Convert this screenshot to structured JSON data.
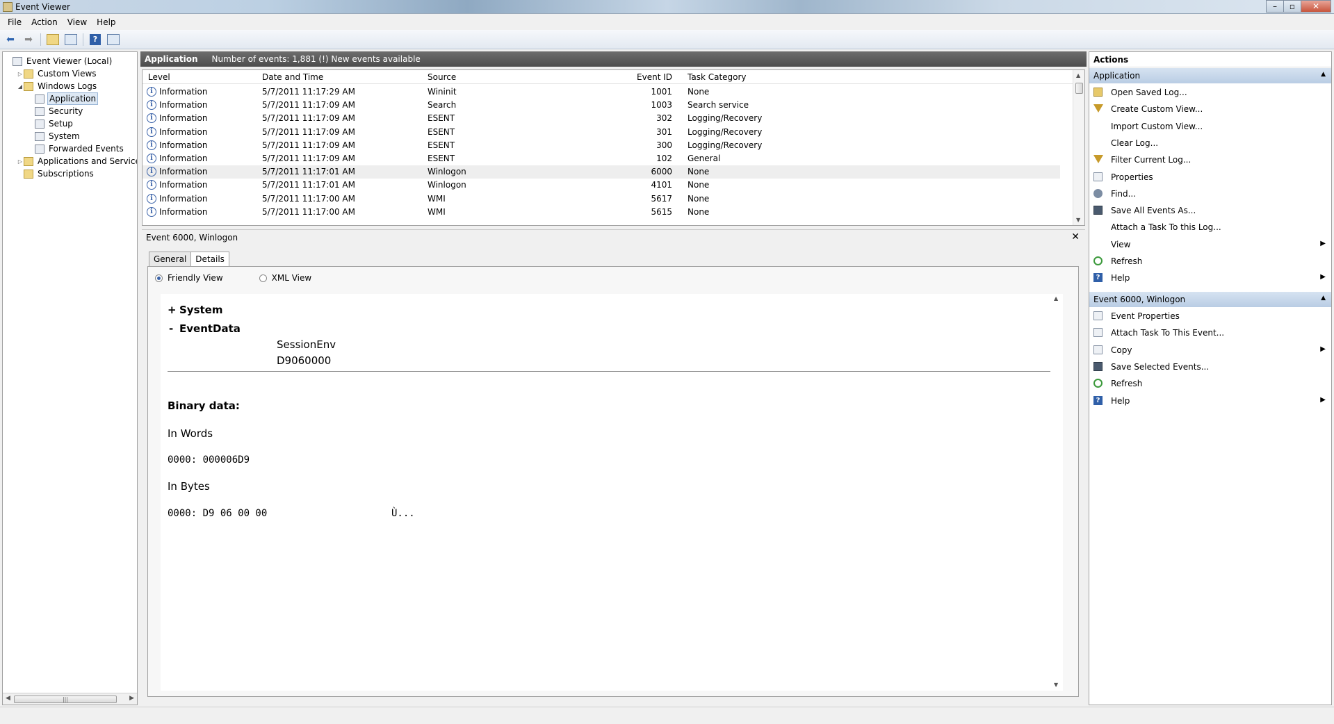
{
  "window": {
    "title": "Event Viewer",
    "controls": [
      "–",
      "▫",
      "✕"
    ]
  },
  "menu": [
    "File",
    "Action",
    "View",
    "Help"
  ],
  "tree": {
    "items": [
      {
        "label": "Event Viewer (Local)",
        "indent": 0,
        "expander": "",
        "icon": "log",
        "selected": false
      },
      {
        "label": "Custom Views",
        "indent": 1,
        "expander": "▷",
        "icon": "folder",
        "selected": false
      },
      {
        "label": "Windows Logs",
        "indent": 1,
        "expander": "◢",
        "icon": "folder",
        "selected": false
      },
      {
        "label": "Application",
        "indent": 2,
        "expander": "",
        "icon": "log",
        "selected": true
      },
      {
        "label": "Security",
        "indent": 2,
        "expander": "",
        "icon": "log",
        "selected": false
      },
      {
        "label": "Setup",
        "indent": 2,
        "expander": "",
        "icon": "log",
        "selected": false
      },
      {
        "label": "System",
        "indent": 2,
        "expander": "",
        "icon": "log",
        "selected": false
      },
      {
        "label": "Forwarded Events",
        "indent": 2,
        "expander": "",
        "icon": "log",
        "selected": false
      },
      {
        "label": "Applications and Services Lo",
        "indent": 1,
        "expander": "▷",
        "icon": "folder",
        "selected": false
      },
      {
        "label": "Subscriptions",
        "indent": 1,
        "expander": "",
        "icon": "folder",
        "selected": false
      }
    ]
  },
  "log_header": {
    "name": "Application",
    "summary": "Number of events: 1,881 (!) New events available"
  },
  "events": {
    "columns": [
      "Level",
      "Date and Time",
      "Source",
      "Event ID",
      "Task Category"
    ],
    "rows": [
      {
        "level": "Information",
        "date": "5/7/2011 11:17:29 AM",
        "source": "Wininit",
        "id": "1001",
        "category": "None",
        "selected": false
      },
      {
        "level": "Information",
        "date": "5/7/2011 11:17:09 AM",
        "source": "Search",
        "id": "1003",
        "category": "Search service",
        "selected": false
      },
      {
        "level": "Information",
        "date": "5/7/2011 11:17:09 AM",
        "source": "ESENT",
        "id": "302",
        "category": "Logging/Recovery",
        "selected": false
      },
      {
        "level": "Information",
        "date": "5/7/2011 11:17:09 AM",
        "source": "ESENT",
        "id": "301",
        "category": "Logging/Recovery",
        "selected": false
      },
      {
        "level": "Information",
        "date": "5/7/2011 11:17:09 AM",
        "source": "ESENT",
        "id": "300",
        "category": "Logging/Recovery",
        "selected": false
      },
      {
        "level": "Information",
        "date": "5/7/2011 11:17:09 AM",
        "source": "ESENT",
        "id": "102",
        "category": "General",
        "selected": false
      },
      {
        "level": "Information",
        "date": "5/7/2011 11:17:01 AM",
        "source": "Winlogon",
        "id": "6000",
        "category": "None",
        "selected": true
      },
      {
        "level": "Information",
        "date": "5/7/2011 11:17:01 AM",
        "source": "Winlogon",
        "id": "4101",
        "category": "None",
        "selected": false
      },
      {
        "level": "Information",
        "date": "5/7/2011 11:17:00 AM",
        "source": "WMI",
        "id": "5617",
        "category": "None",
        "selected": false
      },
      {
        "level": "Information",
        "date": "5/7/2011 11:17:00 AM",
        "source": "WMI",
        "id": "5615",
        "category": "None",
        "selected": false
      }
    ]
  },
  "detail": {
    "title": "Event 6000, Winlogon",
    "tabs": [
      "General",
      "Details"
    ],
    "active_tab": "Details",
    "views": {
      "friendly": "Friendly View",
      "xml": "XML View"
    },
    "system_sign": "+",
    "system_label": "System",
    "eventdata_sign": "-",
    "eventdata_label": "EventData",
    "eventdata_values": [
      "SessionEnv",
      "D9060000"
    ],
    "binary_title": "Binary data:",
    "in_words_label": "In Words",
    "in_words_value": "0000: 000006D9",
    "in_bytes_label": "In Bytes",
    "in_bytes_value": "0000: D9 06 00 00",
    "in_bytes_ascii": "Ù..."
  },
  "actions": {
    "title": "Actions",
    "group1": "Application",
    "group1_items": [
      {
        "label": "Open Saved Log...",
        "icon": "open",
        "sub": false
      },
      {
        "label": "Create Custom View...",
        "icon": "filter",
        "sub": false
      },
      {
        "label": "Import Custom View...",
        "icon": "",
        "sub": false
      },
      {
        "label": "Clear Log...",
        "icon": "",
        "sub": false
      },
      {
        "label": "Filter Current Log...",
        "icon": "filter",
        "sub": false
      },
      {
        "label": "Properties",
        "icon": "doc",
        "sub": false
      },
      {
        "label": "Find...",
        "icon": "find",
        "sub": false
      },
      {
        "label": "Save All Events As...",
        "icon": "save",
        "sub": false
      },
      {
        "label": "Attach a Task To this Log...",
        "icon": "",
        "sub": false
      },
      {
        "label": "View",
        "icon": "",
        "sub": true
      },
      {
        "label": "Refresh",
        "icon": "refresh",
        "sub": false
      },
      {
        "label": "Help",
        "icon": "help",
        "sub": true
      }
    ],
    "group2": "Event 6000, Winlogon",
    "group2_items": [
      {
        "label": "Event Properties",
        "icon": "doc",
        "sub": false
      },
      {
        "label": "Attach Task To This Event...",
        "icon": "doc",
        "sub": false
      },
      {
        "label": "Copy",
        "icon": "doc",
        "sub": true
      },
      {
        "label": "Save Selected Events...",
        "icon": "save",
        "sub": false
      },
      {
        "label": "Refresh",
        "icon": "refresh",
        "sub": false
      },
      {
        "label": "Help",
        "icon": "help",
        "sub": true
      }
    ]
  }
}
